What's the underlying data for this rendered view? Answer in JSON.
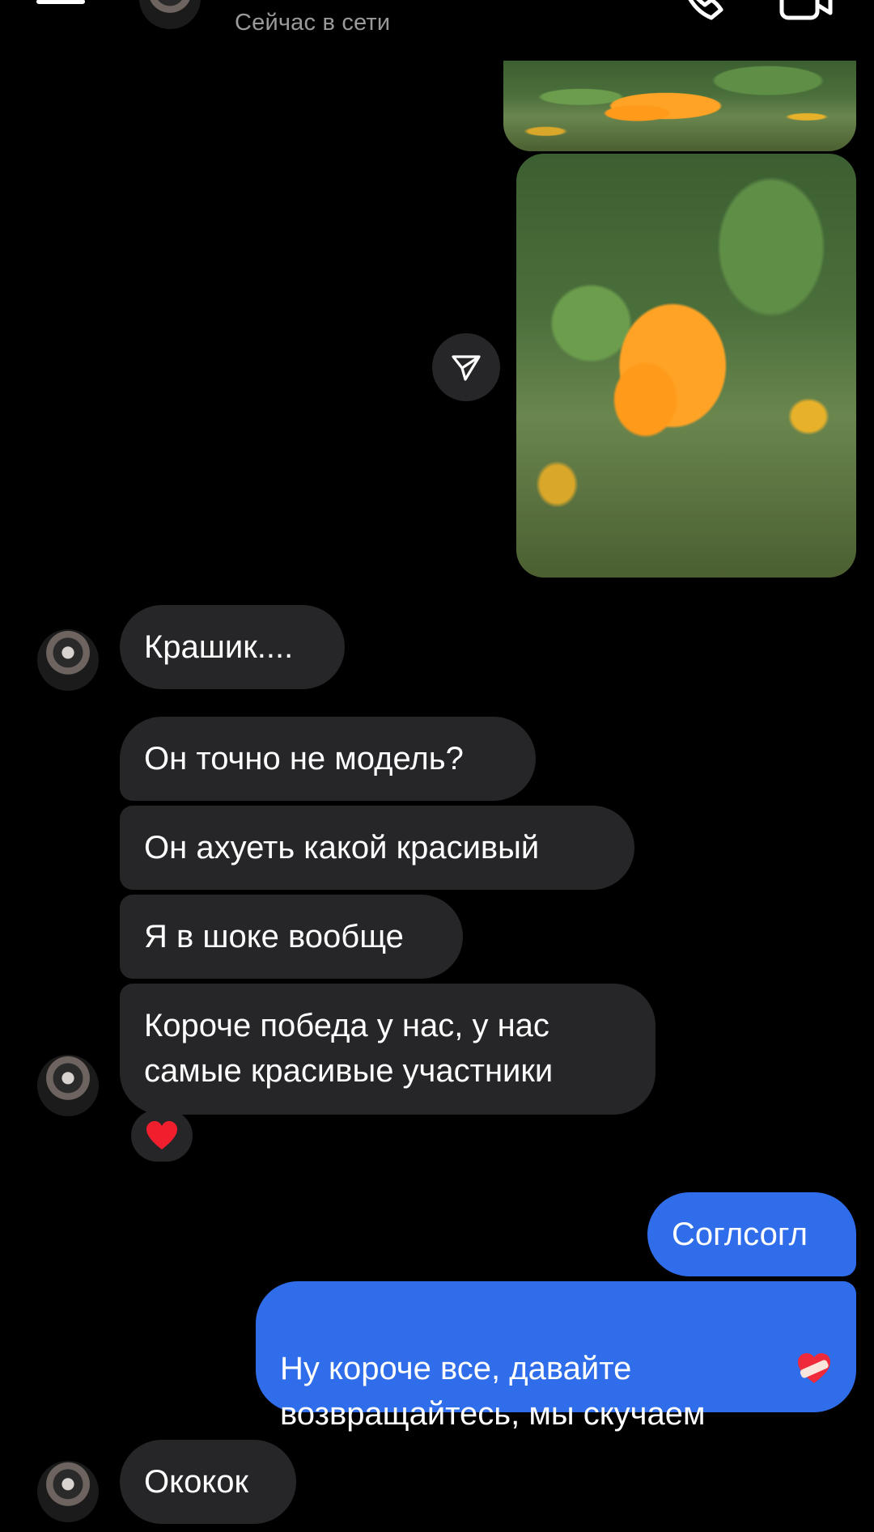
{
  "header": {
    "status": "Сейчас в сети",
    "icons": {
      "back": "arrow-left-icon",
      "phone": "phone-icon",
      "video": "video-camera-icon"
    }
  },
  "messages": {
    "incoming": [
      {
        "text": "Крашик...."
      },
      {
        "text": "Он точно не модель?"
      },
      {
        "text": "Он ахуеть какой красивый"
      },
      {
        "text": "Я в шоке вообще"
      },
      {
        "text": "Короче победа у нас, у нас\nсамые красивые участники"
      },
      {
        "text": "Ококок"
      }
    ],
    "outgoing": [
      {
        "text": "Соглсогл"
      },
      {
        "text": "Ну короче все, давайте\nвозвращайтесь, мы скучаем"
      }
    ],
    "reaction": "heart-emoji",
    "outgoing_emoji": "heart-with-bandage-emoji"
  },
  "colors": {
    "background": "#000000",
    "incoming_bubble": "#262629",
    "outgoing_bubble": "#2f6dea",
    "status_text": "#9a9a9a"
  }
}
